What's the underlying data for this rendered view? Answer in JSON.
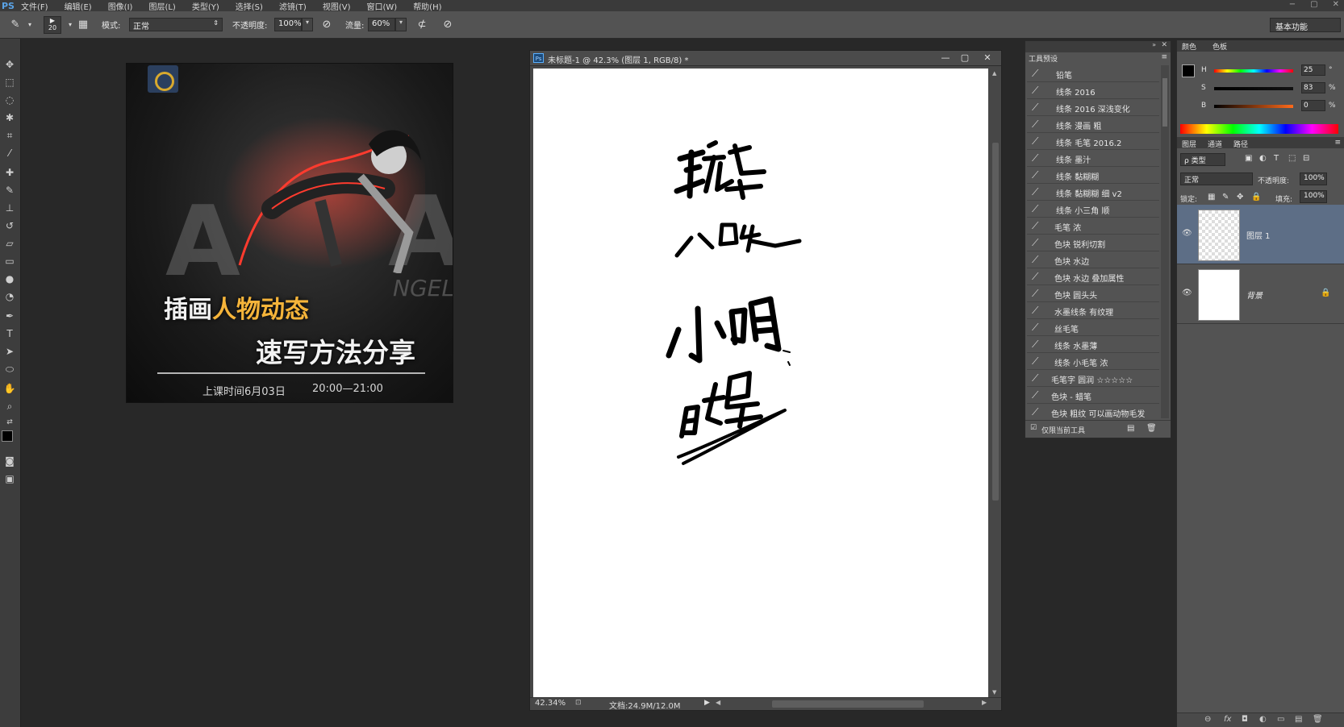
{
  "menubar": {
    "logo": "PS",
    "items": [
      "文件(F)",
      "编辑(E)",
      "图像(I)",
      "图层(L)",
      "类型(Y)",
      "选择(S)",
      "滤镜(T)",
      "视图(V)",
      "窗口(W)",
      "帮助(H)"
    ],
    "window_controls": [
      "−",
      "▢",
      "✕"
    ]
  },
  "options": {
    "brush_size": "20",
    "mode_label": "模式:",
    "mode_value": "正常",
    "opacity_label": "不透明度:",
    "opacity_value": "100%",
    "flow_label": "流量:",
    "flow_value": "60%",
    "workspace": "基本功能"
  },
  "poster": {
    "title_part1": "插画",
    "title_part2": "人物动态",
    "subtitle": "速写方法分享",
    "time_label": "上课时间6月03日",
    "time_value": "20:00—21:00",
    "bg_letters": "ALITA",
    "bg_word": "NGEL"
  },
  "document": {
    "title": "未标题-1 @ 42.3% (图层 1, RGB/8) *",
    "zoom": "42.34%",
    "doc_info": "文档:24.9M/12.0M"
  },
  "presets": {
    "panel_title": "工具预设",
    "items": [
      "铅笔",
      "线条 2016",
      "线条 2016 深浅变化",
      "线条 漫画 粗",
      "线条 毛笔 2016.2",
      "线条 墨汁",
      "线条 黏糊糊",
      "线条 黏糊糊 细 v2",
      "线条 小三角 顺",
      "毛笔 浓",
      "色块 锐利切割",
      "色块 水边",
      "色块 水边 叠加属性",
      "色块 圆头头",
      "水墨线条 有纹理",
      "丝毛笔",
      "线条 水墨薄",
      "线条 小毛笔 浓",
      "毛笔字 圆润 ☆☆☆☆☆",
      "色块 - 蜡笔",
      "色块 粗纹 可以画动物毛发"
    ],
    "footer_label": "仅限当前工具"
  },
  "color_panel": {
    "tabs": [
      "颜色",
      "色板"
    ],
    "h_label": "H",
    "h_value": "25",
    "s_label": "S",
    "s_value": "83",
    "b_label": "B",
    "b_value": "0",
    "percent": "%"
  },
  "layers_panel": {
    "tabs": [
      "图层",
      "通道",
      "路径"
    ],
    "filter": "ρ 类型",
    "blend": "正常",
    "opacity_label": "不透明度:",
    "opacity_value": "100%",
    "lock_label": "锁定:",
    "fill_label": "填充:",
    "fill_value": "100%",
    "layers": [
      {
        "name": "图层 1"
      },
      {
        "name": "背景"
      }
    ],
    "footer_icons": "⊖  fx  ◘  ◐  ▭  ▤  🗑"
  }
}
